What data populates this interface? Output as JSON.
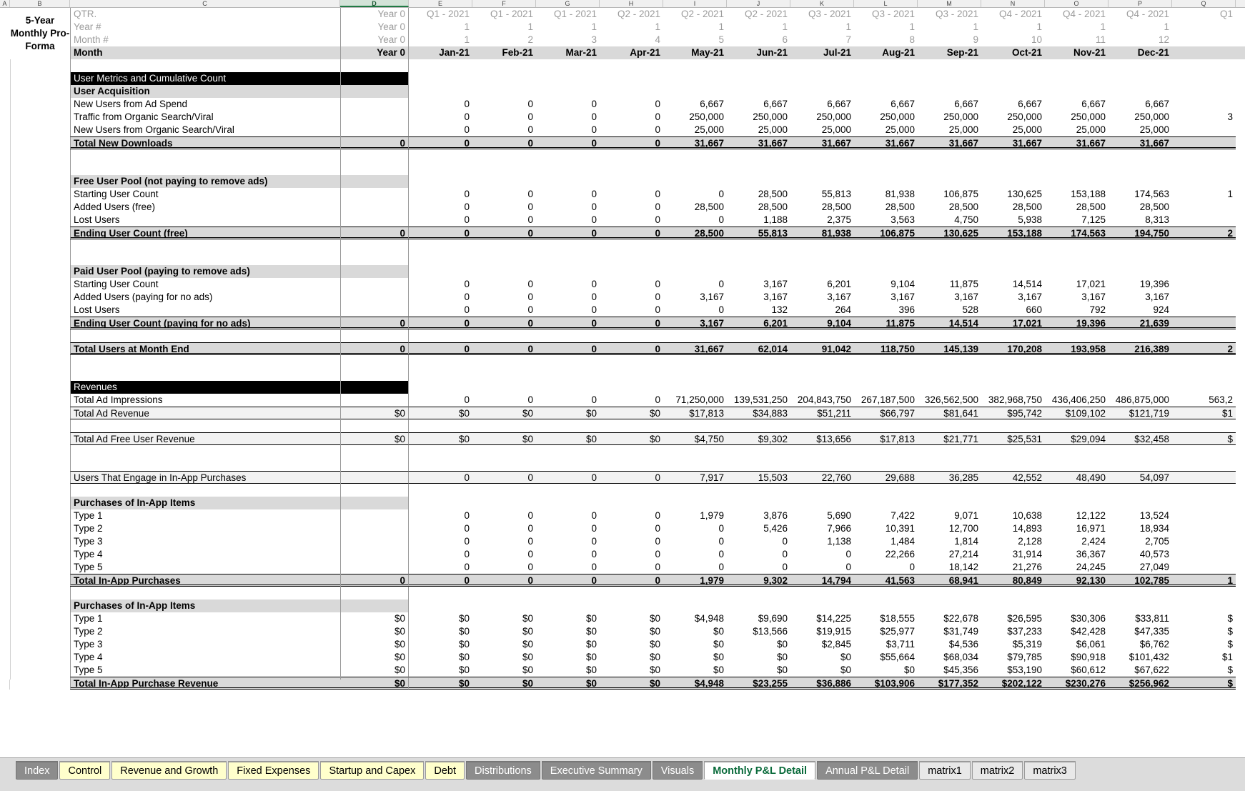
{
  "app": {
    "title_block": "5-Year Monthly Pro-Forma",
    "selected_column": "D"
  },
  "columns": {
    "letters": [
      "A",
      "B",
      "C",
      "D",
      "E",
      "F",
      "G",
      "H",
      "I",
      "J",
      "K",
      "L",
      "M",
      "N",
      "O",
      "P",
      "Q"
    ],
    "year0_label": "Year 0"
  },
  "header_rows": [
    {
      "label": "QTR.",
      "year0": "Year 0",
      "values": [
        "Q1 - 2021",
        "Q1 - 2021",
        "Q1 - 2021",
        "Q2 - 2021",
        "Q2 - 2021",
        "Q2 - 2021",
        "Q3 - 2021",
        "Q3 - 2021",
        "Q3 - 2021",
        "Q4 - 2021",
        "Q4 - 2021",
        "Q4 - 2021",
        "Q1"
      ]
    },
    {
      "label": "Year #",
      "year0": "Year 0",
      "values": [
        "1",
        "1",
        "1",
        "1",
        "1",
        "1",
        "1",
        "1",
        "1",
        "1",
        "1",
        "1",
        ""
      ]
    },
    {
      "label": "Month #",
      "year0": "Year 0",
      "values": [
        "1",
        "2",
        "3",
        "4",
        "5",
        "6",
        "7",
        "8",
        "9",
        "10",
        "11",
        "12",
        ""
      ]
    },
    {
      "label": "Month",
      "year0": "Year 0",
      "values": [
        "Jan-21",
        "Feb-21",
        "Mar-21",
        "Apr-21",
        "May-21",
        "Jun-21",
        "Jul-21",
        "Aug-21",
        "Sep-21",
        "Oct-21",
        "Nov-21",
        "Dec-21",
        ""
      ]
    }
  ],
  "rows": [
    {
      "type": "spacer"
    },
    {
      "type": "band_black",
      "label": "User Metrics and Cumulative Count"
    },
    {
      "type": "band_grey",
      "label": "User Acquisition"
    },
    {
      "type": "data",
      "label": "New Users from Ad Spend",
      "year0": "",
      "values": [
        "0",
        "0",
        "0",
        "0",
        "6,667",
        "6,667",
        "6,667",
        "6,667",
        "6,667",
        "6,667",
        "6,667",
        "6,667",
        ""
      ]
    },
    {
      "type": "data",
      "label": " Traffic from Organic Search/Viral",
      "year0": "",
      "values": [
        "0",
        "0",
        "0",
        "0",
        "250,000",
        "250,000",
        "250,000",
        "250,000",
        "250,000",
        "250,000",
        "250,000",
        "250,000",
        "3"
      ]
    },
    {
      "type": "data",
      "label": "New Users from Organic Search/Viral",
      "year0": "",
      "values": [
        "0",
        "0",
        "0",
        "0",
        "25,000",
        "25,000",
        "25,000",
        "25,000",
        "25,000",
        "25,000",
        "25,000",
        "25,000",
        ""
      ]
    },
    {
      "type": "total",
      "label": "Total New Downloads",
      "year0": "0",
      "values": [
        "0",
        "0",
        "0",
        "0",
        "31,667",
        "31,667",
        "31,667",
        "31,667",
        "31,667",
        "31,667",
        "31,667",
        "31,667",
        ""
      ]
    },
    {
      "type": "spacer"
    },
    {
      "type": "spacer"
    },
    {
      "type": "band_grey",
      "label": "Free User Pool (not paying to remove ads)"
    },
    {
      "type": "data",
      "label": "Starting User Count",
      "year0": "",
      "values": [
        "0",
        "0",
        "0",
        "0",
        "0",
        "28,500",
        "55,813",
        "81,938",
        "106,875",
        "130,625",
        "153,188",
        "174,563",
        "1"
      ]
    },
    {
      "type": "data",
      "label": "Added Users (free)",
      "year0": "",
      "values": [
        "0",
        "0",
        "0",
        "0",
        "28,500",
        "28,500",
        "28,500",
        "28,500",
        "28,500",
        "28,500",
        "28,500",
        "28,500",
        ""
      ]
    },
    {
      "type": "data",
      "label": "Lost Users",
      "year0": "",
      "values": [
        "0",
        "0",
        "0",
        "0",
        "0",
        "1,188",
        "2,375",
        "3,563",
        "4,750",
        "5,938",
        "7,125",
        "8,313",
        ""
      ]
    },
    {
      "type": "total",
      "label": "Ending User Count (free)",
      "year0": "0",
      "values": [
        "0",
        "0",
        "0",
        "0",
        "28,500",
        "55,813",
        "81,938",
        "106,875",
        "130,625",
        "153,188",
        "174,563",
        "194,750",
        "2"
      ]
    },
    {
      "type": "spacer"
    },
    {
      "type": "spacer"
    },
    {
      "type": "band_grey",
      "label": "Paid User Pool (paying to remove ads)"
    },
    {
      "type": "data",
      "label": "Starting User Count",
      "year0": "",
      "values": [
        "0",
        "0",
        "0",
        "0",
        "0",
        "3,167",
        "6,201",
        "9,104",
        "11,875",
        "14,514",
        "17,021",
        "19,396",
        ""
      ]
    },
    {
      "type": "data",
      "label": "Added Users (paying for no ads)",
      "year0": "",
      "values": [
        "0",
        "0",
        "0",
        "0",
        "3,167",
        "3,167",
        "3,167",
        "3,167",
        "3,167",
        "3,167",
        "3,167",
        "3,167",
        ""
      ]
    },
    {
      "type": "data",
      "label": "Lost Users",
      "year0": "",
      "values": [
        "0",
        "0",
        "0",
        "0",
        "0",
        "132",
        "264",
        "396",
        "528",
        "660",
        "792",
        "924",
        ""
      ]
    },
    {
      "type": "total",
      "label": "Ending User Count (paying for no ads)",
      "year0": "0",
      "values": [
        "0",
        "0",
        "0",
        "0",
        "3,167",
        "6,201",
        "9,104",
        "11,875",
        "14,514",
        "17,021",
        "19,396",
        "21,639",
        ""
      ]
    },
    {
      "type": "spacer"
    },
    {
      "type": "total",
      "label": "Total Users at Month End",
      "year0": "0",
      "values": [
        "0",
        "0",
        "0",
        "0",
        "31,667",
        "62,014",
        "91,042",
        "118,750",
        "145,139",
        "170,208",
        "193,958",
        "216,389",
        "2"
      ]
    },
    {
      "type": "spacer"
    },
    {
      "type": "spacer"
    },
    {
      "type": "band_black",
      "label": "Revenues"
    },
    {
      "type": "data",
      "label": "Total Ad Impressions",
      "year0": "",
      "values": [
        "0",
        "0",
        "0",
        "0",
        "71,250,000",
        "139,531,250",
        "204,843,750",
        "267,187,500",
        "326,562,500",
        "382,968,750",
        "436,406,250",
        "486,875,000",
        "563,2"
      ]
    },
    {
      "type": "lite",
      "label": "Total Ad Revenue",
      "year0": "$0",
      "values": [
        "$0",
        "$0",
        "$0",
        "$0",
        "$17,813",
        "$34,883",
        "$51,211",
        "$66,797",
        "$81,641",
        "$95,742",
        "$109,102",
        "$121,719",
        "$1"
      ]
    },
    {
      "type": "spacer"
    },
    {
      "type": "lite",
      "label": "Total Ad Free User Revenue",
      "year0": "$0",
      "values": [
        "$0",
        "$0",
        "$0",
        "$0",
        "$4,750",
        "$9,302",
        "$13,656",
        "$17,813",
        "$21,771",
        "$25,531",
        "$29,094",
        "$32,458",
        "$"
      ]
    },
    {
      "type": "spacer"
    },
    {
      "type": "spacer"
    },
    {
      "type": "lite",
      "label": "Users That Engage in In-App Purchases",
      "year0": "",
      "values": [
        "0",
        "0",
        "0",
        "0",
        "7,917",
        "15,503",
        "22,760",
        "29,688",
        "36,285",
        "42,552",
        "48,490",
        "54,097",
        ""
      ]
    },
    {
      "type": "spacer"
    },
    {
      "type": "band_grey",
      "label": "Purchases of In-App Items"
    },
    {
      "type": "data",
      "label": "Type 1",
      "year0": "",
      "values": [
        "0",
        "0",
        "0",
        "0",
        "1,979",
        "3,876",
        "5,690",
        "7,422",
        "9,071",
        "10,638",
        "12,122",
        "13,524",
        ""
      ]
    },
    {
      "type": "data",
      "label": "Type 2",
      "year0": "",
      "values": [
        "0",
        "0",
        "0",
        "0",
        "0",
        "5,426",
        "7,966",
        "10,391",
        "12,700",
        "14,893",
        "16,971",
        "18,934",
        ""
      ]
    },
    {
      "type": "data",
      "label": "Type 3",
      "year0": "",
      "values": [
        "0",
        "0",
        "0",
        "0",
        "0",
        "0",
        "1,138",
        "1,484",
        "1,814",
        "2,128",
        "2,424",
        "2,705",
        ""
      ]
    },
    {
      "type": "data",
      "label": "Type 4",
      "year0": "",
      "values": [
        "0",
        "0",
        "0",
        "0",
        "0",
        "0",
        "0",
        "22,266",
        "27,214",
        "31,914",
        "36,367",
        "40,573",
        ""
      ]
    },
    {
      "type": "data",
      "label": "Type 5",
      "year0": "",
      "values": [
        "0",
        "0",
        "0",
        "0",
        "0",
        "0",
        "0",
        "0",
        "18,142",
        "21,276",
        "24,245",
        "27,049",
        ""
      ]
    },
    {
      "type": "total",
      "label": "Total In-App Purchases",
      "year0": "0",
      "values": [
        "0",
        "0",
        "0",
        "0",
        "1,979",
        "9,302",
        "14,794",
        "41,563",
        "68,941",
        "80,849",
        "92,130",
        "102,785",
        "1"
      ]
    },
    {
      "type": "spacer"
    },
    {
      "type": "band_grey",
      "label": "Purchases of In-App Items"
    },
    {
      "type": "data",
      "label": "Type 1",
      "year0": "$0",
      "values": [
        "$0",
        "$0",
        "$0",
        "$0",
        "$4,948",
        "$9,690",
        "$14,225",
        "$18,555",
        "$22,678",
        "$26,595",
        "$30,306",
        "$33,811",
        "$"
      ]
    },
    {
      "type": "data",
      "label": "Type 2",
      "year0": "$0",
      "values": [
        "$0",
        "$0",
        "$0",
        "$0",
        "$0",
        "$13,566",
        "$19,915",
        "$25,977",
        "$31,749",
        "$37,233",
        "$42,428",
        "$47,335",
        "$"
      ]
    },
    {
      "type": "data",
      "label": "Type 3",
      "year0": "$0",
      "values": [
        "$0",
        "$0",
        "$0",
        "$0",
        "$0",
        "$0",
        "$2,845",
        "$3,711",
        "$4,536",
        "$5,319",
        "$6,061",
        "$6,762",
        "$"
      ]
    },
    {
      "type": "data",
      "label": "Type 4",
      "year0": "$0",
      "values": [
        "$0",
        "$0",
        "$0",
        "$0",
        "$0",
        "$0",
        "$0",
        "$55,664",
        "$68,034",
        "$79,785",
        "$90,918",
        "$101,432",
        "$1"
      ]
    },
    {
      "type": "data",
      "label": "Type 5",
      "year0": "$0",
      "values": [
        "$0",
        "$0",
        "$0",
        "$0",
        "$0",
        "$0",
        "$0",
        "$0",
        "$45,356",
        "$53,190",
        "$60,612",
        "$67,622",
        "$"
      ]
    },
    {
      "type": "total",
      "label": "Total In-App Purchase Revenue",
      "year0": "$0",
      "values": [
        "$0",
        "$0",
        "$0",
        "$0",
        "$4,948",
        "$23,255",
        "$36,886",
        "$103,906",
        "$177,352",
        "$202,122",
        "$230,276",
        "$256,962",
        "$"
      ]
    }
  ],
  "tabs": [
    {
      "label": "Index",
      "style": "grey"
    },
    {
      "label": "Control",
      "style": "yellow"
    },
    {
      "label": "Revenue and Growth",
      "style": "yellow"
    },
    {
      "label": "Fixed Expenses",
      "style": "yellow"
    },
    {
      "label": "Startup and Capex",
      "style": "yellow"
    },
    {
      "label": "Debt",
      "style": "yellow"
    },
    {
      "label": "Distributions",
      "style": "grey"
    },
    {
      "label": "Executive Summary",
      "style": "grey"
    },
    {
      "label": "Visuals",
      "style": "grey"
    },
    {
      "label": "Monthly P&L Detail",
      "style": "active"
    },
    {
      "label": "Annual P&L Detail",
      "style": "grey"
    },
    {
      "label": "matrix1",
      "style": "plain"
    },
    {
      "label": "matrix2",
      "style": "plain"
    },
    {
      "label": "matrix3",
      "style": "plain"
    }
  ]
}
